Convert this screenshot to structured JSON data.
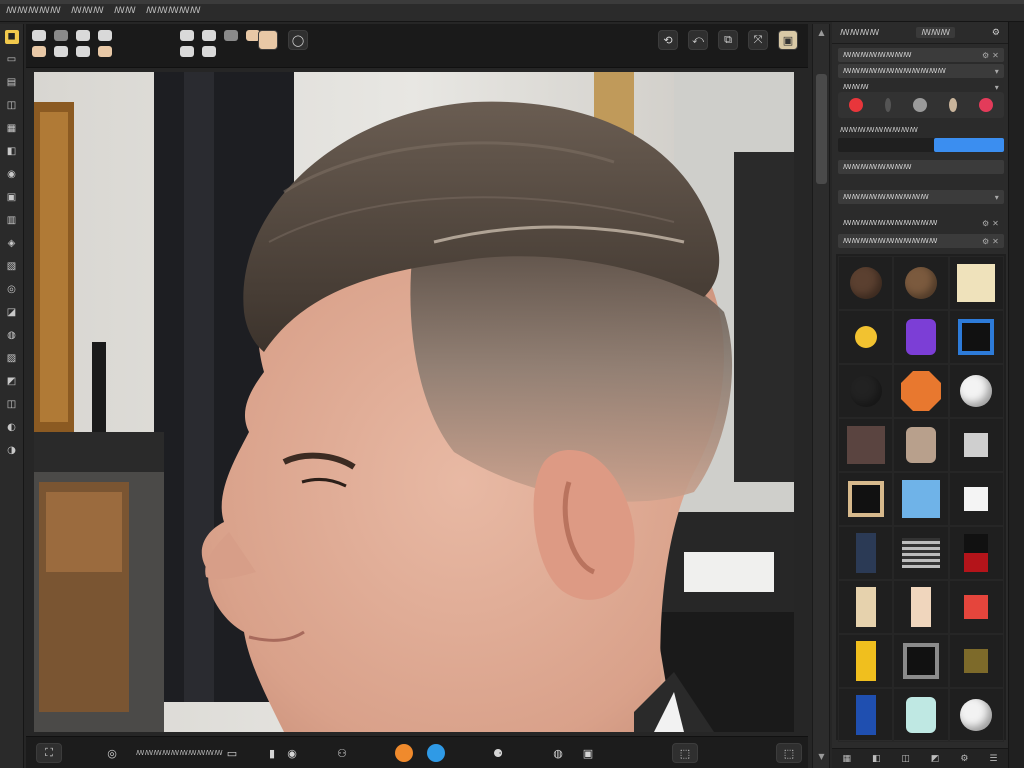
{
  "menu": {
    "items": [
      "ꟿꟿꟿꟿꟿ",
      "ꟿꟿꟿ",
      "ꟿꟿ",
      "ꟿꟿꟿꟿꟿ"
    ]
  },
  "left_toolbar": {
    "tools": [
      "◼",
      "▭",
      "▤",
      "◫",
      "▦",
      "◧",
      "◉",
      "▣",
      "▥",
      "◈",
      "▧",
      "◎",
      "◪",
      "◍",
      "▨",
      "◩",
      "◫",
      "◐",
      "◑"
    ]
  },
  "options_bar": {
    "buttons": [
      "⟲",
      "⤺",
      "⧉",
      "⤧",
      "▣"
    ]
  },
  "bottom_bar": {
    "label": "ꟿꟿꟿꟿꟿꟿꟿꟿꟿꟿ",
    "buttons": [
      "⛶",
      "◎",
      "▭",
      "▮",
      "◉",
      "⚇",
      "⚈",
      "◍",
      "▣",
      "⬚"
    ],
    "dot_colors": [
      "#f08a2c",
      "#2f9ae6"
    ]
  },
  "right_panel": {
    "header_title": "ꟿꟿꟿꟿ",
    "header_badge": "ꟿꟿꟿ",
    "rows": [
      {
        "label": "ꟿꟿꟿꟿꟿꟿꟿꟿ",
        "end": "⚙ ✕"
      },
      {
        "label": "ꟿꟿꟿꟿꟿꟿꟿꟿꟿꟿꟿꟿ",
        "end": "▾"
      },
      {
        "label": "ꟿꟿꟿ",
        "end": "▾"
      },
      {
        "label": "ꟿꟿꟿꟿꟿꟿꟿꟿ",
        "end": ""
      },
      {
        "label": "ꟿꟿꟿꟿꟿꟿꟿꟿꟿꟿ",
        "end": "▾"
      },
      {
        "label": "ꟿꟿꟿꟿꟿꟿꟿꟿꟿꟿꟿ",
        "end": "⚙ ✕"
      },
      {
        "label": "ꟿꟿꟿꟿꟿꟿꟿꟿꟿꟿꟿ",
        "end": "⚙ ✕"
      }
    ],
    "swatches": [
      "#e8363b",
      "#555555",
      "#9a9a9a",
      "#c9b49b",
      "#e33b5a"
    ],
    "slider_label": "ꟿꟿꟿꟿꟿꟿꟿꟿꟿ",
    "slider_value": 0.42,
    "footer_icons": [
      "▦",
      "◧",
      "◫",
      "◩",
      "⚙",
      "☰"
    ]
  },
  "asset_grid": {
    "items": [
      {
        "name": "hair-swatch-brown",
        "color": "#5b4030",
        "shape": "circle"
      },
      {
        "name": "hair-swatch-walnut",
        "color": "#7b5a3e",
        "shape": "circle"
      },
      {
        "name": "swatch-cream",
        "color": "#efe2bb",
        "shape": "square"
      },
      {
        "name": "swatch-yellow",
        "color": "#f2c230",
        "shape": "circle-small"
      },
      {
        "name": "swatch-purple",
        "color": "#7c3ed6",
        "shape": "rounded"
      },
      {
        "name": "swatch-blue-frame",
        "color": "#2d7bd9",
        "shape": "frame"
      },
      {
        "name": "swatch-dark-sphere",
        "color": "#222222",
        "shape": "circle"
      },
      {
        "name": "swatch-orange-hex",
        "color": "#e8782f",
        "shape": "octagon"
      },
      {
        "name": "swatch-white-circle",
        "color": "#f3f3f3",
        "shape": "circle"
      },
      {
        "name": "swatch-umber",
        "color": "#5a4440",
        "shape": "square"
      },
      {
        "name": "swatch-tan",
        "color": "#b8a08c",
        "shape": "rounded"
      },
      {
        "name": "swatch-light-gray",
        "color": "#cfcfcf",
        "shape": "square-small"
      },
      {
        "name": "swatch-tan-frame",
        "color": "#d7b98c",
        "shape": "frame"
      },
      {
        "name": "swatch-sky",
        "color": "#6fb3e8",
        "shape": "square"
      },
      {
        "name": "swatch-white-square",
        "color": "#f4f4f4",
        "shape": "square-small"
      },
      {
        "name": "swatch-navy-strip",
        "color": "#2b3a55",
        "shape": "strip"
      },
      {
        "name": "swatch-striped",
        "color": "#bdbdbd",
        "shape": "stripes"
      },
      {
        "name": "swatch-black-red",
        "color": "#b4141a",
        "shape": "split"
      },
      {
        "name": "swatch-sand",
        "color": "#e6d2ad",
        "shape": "strip"
      },
      {
        "name": "swatch-peach",
        "color": "#f0d6bd",
        "shape": "strip"
      },
      {
        "name": "swatch-red",
        "color": "#e5453c",
        "shape": "square-small"
      },
      {
        "name": "swatch-gold",
        "color": "#f0bf1e",
        "shape": "strip"
      },
      {
        "name": "swatch-gray-frame",
        "color": "#8b8b8b",
        "shape": "frame"
      },
      {
        "name": "swatch-olive",
        "color": "#7d6a2a",
        "shape": "square-small"
      },
      {
        "name": "swatch-blue-bar",
        "color": "#1f4fb0",
        "shape": "strip"
      },
      {
        "name": "swatch-mint-flag",
        "color": "#bfe8e3",
        "shape": "rounded"
      },
      {
        "name": "swatch-white-badge",
        "color": "#f2f2f2",
        "shape": "circle"
      }
    ]
  }
}
